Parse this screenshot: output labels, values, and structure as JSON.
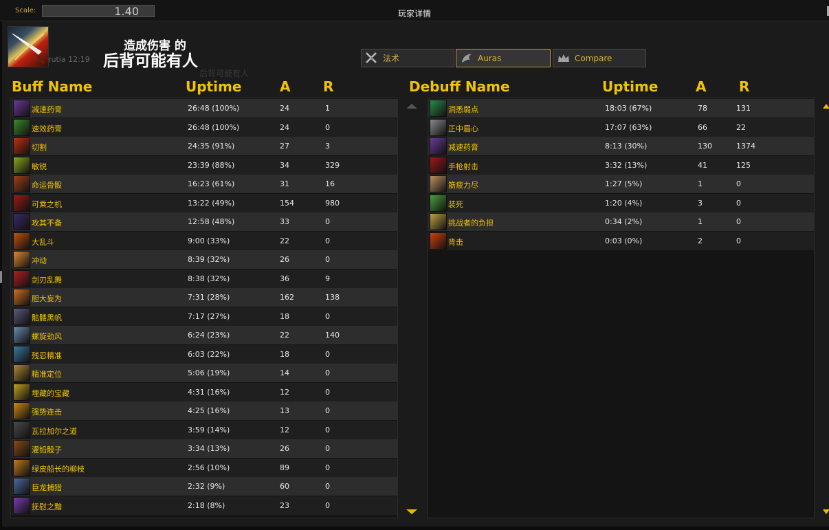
{
  "topbar": {
    "scale_label": "Scale:",
    "scale_value": "1.40",
    "window_title": "玩家详情"
  },
  "player": {
    "name": "rutia 12:19"
  },
  "overlay": {
    "line1": "造成伤害 的",
    "line2": "后背可能有人",
    "ghost": "后背可能有人"
  },
  "tabs": [
    {
      "label": "法术",
      "icon": "sword-icon",
      "active": false
    },
    {
      "label": "Auras",
      "icon": "dragon-icon",
      "active": true
    },
    {
      "label": "Compare",
      "icon": "crown-icon",
      "active": false
    }
  ],
  "buff_headers": {
    "name": "Buff Name",
    "uptime": "Uptime",
    "a": "A",
    "r": "R"
  },
  "debuff_headers": {
    "name": "Debuff Name",
    "uptime": "Uptime",
    "a": "A",
    "r": "R"
  },
  "buffs": [
    {
      "name": "减速药膏",
      "uptime": "26:48 (100%)",
      "a": "24",
      "r": "1",
      "icon_color": "#6a3a9a"
    },
    {
      "name": "速效药膏",
      "uptime": "26:48 (100%)",
      "a": "24",
      "r": "0",
      "icon_color": "#3a8a2a"
    },
    {
      "name": "切割",
      "uptime": "24:35 (91%)",
      "a": "27",
      "r": "3",
      "icon_color": "#c03010"
    },
    {
      "name": "敏锐",
      "uptime": "23:39 (88%)",
      "a": "34",
      "r": "329",
      "icon_color": "#8aa820"
    },
    {
      "name": "命运骨骰",
      "uptime": "16:23 (61%)",
      "a": "31",
      "r": "16",
      "icon_color": "#a04018"
    },
    {
      "name": "可乘之机",
      "uptime": "13:22 (49%)",
      "a": "154",
      "r": "980",
      "icon_color": "#a01818"
    },
    {
      "name": "攻其不备",
      "uptime": "12:58 (48%)",
      "a": "33",
      "r": "0",
      "icon_color": "#3a2a6a"
    },
    {
      "name": "大乱斗",
      "uptime": "9:00 (33%)",
      "a": "22",
      "r": "0",
      "icon_color": "#c05010"
    },
    {
      "name": "冲动",
      "uptime": "8:39 (32%)",
      "a": "26",
      "r": "0",
      "icon_color": "#e08a30"
    },
    {
      "name": "剑刃乱舞",
      "uptime": "8:38 (32%)",
      "a": "36",
      "r": "9",
      "icon_color": "#b02020"
    },
    {
      "name": "胆大妄为",
      "uptime": "7:31 (28%)",
      "a": "162",
      "r": "138",
      "icon_color": "#d07020"
    },
    {
      "name": "骷髅黑帆",
      "uptime": "7:17 (27%)",
      "a": "18",
      "r": "0",
      "icon_color": "#5a5a7a"
    },
    {
      "name": "螺旋劲风",
      "uptime": "6:24 (23%)",
      "a": "22",
      "r": "140",
      "icon_color": "#6a8ab0"
    },
    {
      "name": "残忍精准",
      "uptime": "6:03 (22%)",
      "a": "18",
      "r": "0",
      "icon_color": "#3a7aa0"
    },
    {
      "name": "精准定位",
      "uptime": "5:06 (19%)",
      "a": "14",
      "r": "0",
      "icon_color": "#b08a30"
    },
    {
      "name": "埋藏的宝藏",
      "uptime": "4:31 (16%)",
      "a": "12",
      "r": "0",
      "icon_color": "#c0a020"
    },
    {
      "name": "强势连击",
      "uptime": "4:25 (16%)",
      "a": "13",
      "r": "0",
      "icon_color": "#d08a10"
    },
    {
      "name": "瓦拉加尔之道",
      "uptime": "3:59 (14%)",
      "a": "12",
      "r": "0",
      "icon_color": "#4a4a4a"
    },
    {
      "name": "灌铅骰子",
      "uptime": "3:34 (13%)",
      "a": "26",
      "r": "0",
      "icon_color": "#8a4a18"
    },
    {
      "name": "绿皮船长的柳枝",
      "uptime": "2:56 (10%)",
      "a": "89",
      "r": "0",
      "icon_color": "#c07a20"
    },
    {
      "name": "巨龙捕猎",
      "uptime": "2:32 (9%)",
      "a": "60",
      "r": "0",
      "icon_color": "#4a6aa0"
    },
    {
      "name": "抚慰之黯",
      "uptime": "2:18 (8%)",
      "a": "23",
      "r": "0",
      "icon_color": "#7a3ab0"
    }
  ],
  "debuffs": [
    {
      "name": "洞悉弱点",
      "uptime": "18:03 (67%)",
      "a": "78",
      "r": "131",
      "icon_color": "#2a8a4a"
    },
    {
      "name": "正中眉心",
      "uptime": "17:07 (63%)",
      "a": "66",
      "r": "22",
      "icon_color": "#8a8a8a"
    },
    {
      "name": "减速药膏",
      "uptime": "8:13 (30%)",
      "a": "130",
      "r": "1374",
      "icon_color": "#6a3a9a"
    },
    {
      "name": "手枪射击",
      "uptime": "3:32 (13%)",
      "a": "41",
      "r": "125",
      "icon_color": "#a01818"
    },
    {
      "name": "筋疲力尽",
      "uptime": "1:27 (5%)",
      "a": "1",
      "r": "0",
      "icon_color": "#c09060"
    },
    {
      "name": "装死",
      "uptime": "1:20 (4%)",
      "a": "3",
      "r": "0",
      "icon_color": "#4aa040"
    },
    {
      "name": "挑战者的负担",
      "uptime": "0:34 (2%)",
      "a": "1",
      "r": "0",
      "icon_color": "#c0a040"
    },
    {
      "name": "背击",
      "uptime": "0:03 (0%)",
      "a": "2",
      "r": "0",
      "icon_color": "#d04010"
    }
  ]
}
